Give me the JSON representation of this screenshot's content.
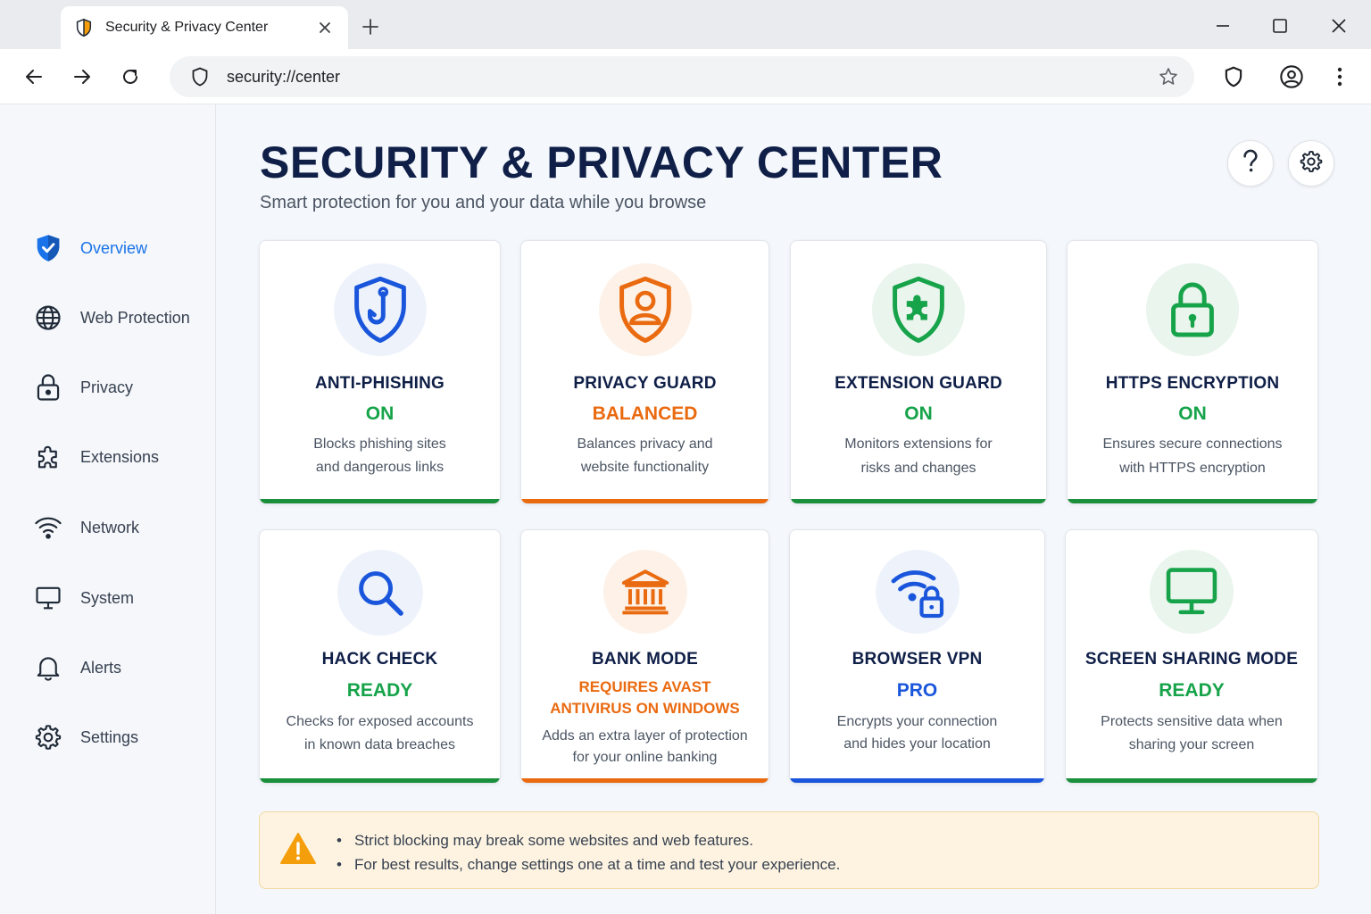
{
  "browser": {
    "tab_title": "Security & Privacy Center",
    "url": "security://center",
    "icons": {
      "favicon": "shield-favicon-icon",
      "close": "close-icon",
      "new_tab": "plus-icon",
      "minimize": "minimize-icon",
      "maximize": "maximize-icon",
      "window_close": "window-close-icon",
      "back": "arrow-left-icon",
      "forward": "arrow-right-icon",
      "reload": "reload-icon",
      "site_info": "shield-icon",
      "bookmark": "star-icon",
      "extension": "shield-icon",
      "profile": "user-circle-icon",
      "menu": "kebab-menu-icon"
    }
  },
  "sidebar": {
    "items": [
      {
        "label": "Overview",
        "icon": "shield-check-icon",
        "active": true
      },
      {
        "label": "Web Protection",
        "icon": "globe-icon"
      },
      {
        "label": "Privacy",
        "icon": "lock-icon"
      },
      {
        "label": "Extensions",
        "icon": "puzzle-icon"
      },
      {
        "label": "Network",
        "icon": "wifi-icon"
      },
      {
        "label": "System",
        "icon": "monitor-icon"
      },
      {
        "label": "Alerts",
        "icon": "bell-icon"
      },
      {
        "label": "Settings",
        "icon": "gear-icon"
      }
    ]
  },
  "header": {
    "title": "SECURITY & PRIVACY CENTER",
    "subtitle": "Smart protection for you and your data while you browse",
    "help_icon": "help-icon",
    "settings_icon": "gear-icon"
  },
  "cards": [
    {
      "title": "ANTI-PHISHING",
      "status": "ON",
      "desc1": "Blocks phishing sites",
      "desc2": "and dangerous links",
      "icon": "shield-hook-icon",
      "accent": "#1a8f3c"
    },
    {
      "title": "PRIVACY GUARD",
      "status": "BALANCED",
      "desc1": "Balances privacy and",
      "desc2": "website functionality",
      "icon": "shield-user-icon",
      "accent": "#ea6a10"
    },
    {
      "title": "EXTENSION GUARD",
      "status": "ON",
      "desc1": "Monitors extensions for",
      "desc2": "risks and changes",
      "icon": "shield-puzzle-icon",
      "accent": "#1a8f3c"
    },
    {
      "title": "HTTPS ENCRYPTION",
      "status": "ON",
      "desc1": "Ensures secure connections",
      "desc2": "with HTTPS encryption",
      "icon": "padlock-icon",
      "accent": "#1a8f3c"
    },
    {
      "title": "HACK CHECK",
      "status": "READY",
      "desc1": "Checks for exposed accounts",
      "desc2": "in known data breaches",
      "icon": "magnifier-icon",
      "accent": "#1a8f3c"
    },
    {
      "title": "BANK MODE",
      "status1": "REQUIRES AVAST",
      "status2": "ANTIVIRUS ON WINDOWS",
      "desc1": "Adds an extra layer of protection",
      "desc2": "for your online banking",
      "icon": "bank-icon",
      "accent": "#ea6a10"
    },
    {
      "title": "BROWSER VPN",
      "status": "PRO",
      "desc1": "Encrypts your connection",
      "desc2": "and hides your location",
      "icon": "wifi-lock-icon",
      "accent": "#1a56db"
    },
    {
      "title": "SCREEN SHARING MODE",
      "status": "READY",
      "desc1": "Protects sensitive data when",
      "desc2": "sharing your screen",
      "icon": "screen-icon",
      "accent": "#1a8f3c"
    }
  ],
  "warning": {
    "icon": "warning-triangle-icon",
    "lines": [
      "Strict blocking may break some websites and web features.",
      "For best results, change settings one at a time and test your experience."
    ]
  }
}
